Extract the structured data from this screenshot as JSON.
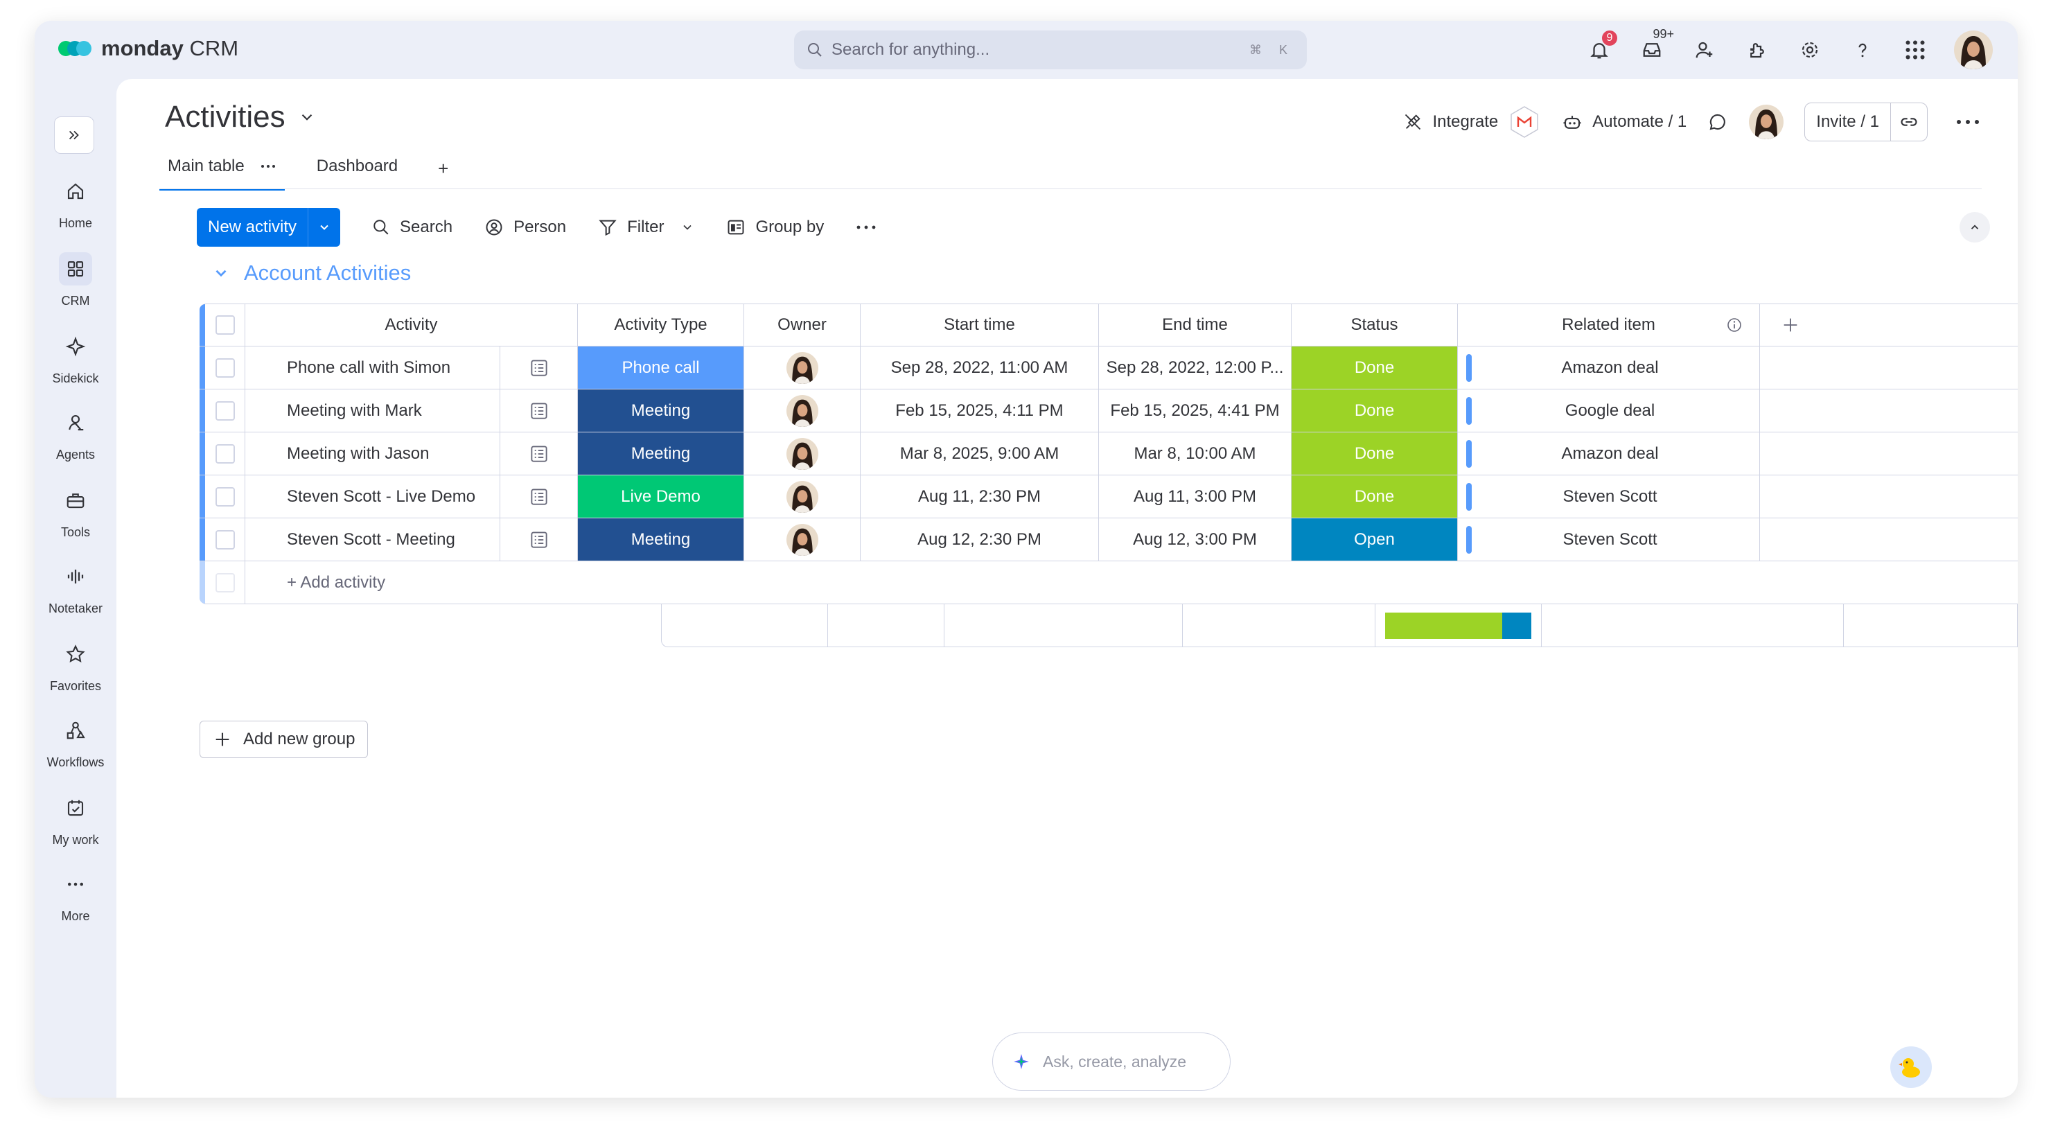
{
  "app": {
    "logo_brand": "monday",
    "logo_product": "CRM",
    "logo_colors": [
      "#00ca72",
      "#00a3b8",
      "#36c3e0"
    ]
  },
  "search": {
    "placeholder": "Search for anything...",
    "shortcut": "⌘ K"
  },
  "topbar": {
    "notifications_badge": "9",
    "inbox_badge": "99+",
    "icons": [
      "bell-icon",
      "inbox-icon",
      "invite-members-icon",
      "apps-icon",
      "settings-icon",
      "help-icon",
      "app-grid-icon",
      "avatar"
    ]
  },
  "rail": {
    "items": [
      {
        "label": "Home",
        "icon": "home-icon"
      },
      {
        "label": "CRM",
        "icon": "grid-icon",
        "active": true
      },
      {
        "label": "Sidekick",
        "icon": "sparkle-icon"
      },
      {
        "label": "Agents",
        "icon": "agents-icon"
      },
      {
        "label": "Tools",
        "icon": "toolbox-icon"
      },
      {
        "label": "Notetaker",
        "icon": "waveform-icon"
      },
      {
        "label": "Favorites",
        "icon": "star-icon"
      },
      {
        "label": "Workflows",
        "icon": "workflows-icon"
      },
      {
        "label": "My work",
        "icon": "calendar-check-icon"
      },
      {
        "label": "More",
        "icon": "more-icon"
      }
    ]
  },
  "board": {
    "title": "Activities",
    "integrate_label": "Integrate",
    "automate_label": "Automate / 1",
    "invite_label": "Invite / 1",
    "tabs": [
      {
        "label": "Main table",
        "active": true
      },
      {
        "label": "Dashboard"
      }
    ],
    "add_tab": "+"
  },
  "toolbar": {
    "new_label": "New activity",
    "search_label": "Search",
    "person_label": "Person",
    "filter_label": "Filter",
    "group_by_label": "Group by"
  },
  "group": {
    "title": "Account Activities",
    "color": "#579bfc",
    "columns": {
      "activity": "Activity",
      "type": "Activity Type",
      "owner": "Owner",
      "start": "Start time",
      "end": "End time",
      "status": "Status",
      "related": "Related item"
    },
    "rows": [
      {
        "activity": "Phone call with Simon",
        "type": "Phone call",
        "type_color": "#579bfc",
        "start": "Sep 28, 2022, 11:00 AM",
        "end": "Sep 28, 2022, 12:00 P...",
        "status": "Done",
        "status_color": "#9cd326",
        "related": "Amazon deal"
      },
      {
        "activity": "Meeting with Mark",
        "type": "Meeting",
        "type_color": "#225091",
        "start": "Feb 15, 2025, 4:11 PM",
        "end": "Feb 15, 2025, 4:41 PM",
        "status": "Done",
        "status_color": "#9cd326",
        "related": "Google deal"
      },
      {
        "activity": "Meeting with Jason",
        "type": "Meeting",
        "type_color": "#225091",
        "start": "Mar 8, 2025, 9:00 AM",
        "end": "Mar 8, 10:00 AM",
        "status": "Done",
        "status_color": "#9cd326",
        "related": "Amazon deal"
      },
      {
        "activity": "Steven Scott - Live Demo",
        "type": "Live Demo",
        "type_color": "#00c875",
        "start": "Aug 11, 2:30 PM",
        "end": "Aug 11, 3:00 PM",
        "status": "Done",
        "status_color": "#9cd326",
        "related": "Steven Scott"
      },
      {
        "activity": "Steven Scott - Meeting",
        "type": "Meeting",
        "type_color": "#225091",
        "start": "Aug 12, 2:30 PM",
        "end": "Aug 12, 3:00 PM",
        "status": "Open",
        "status_color": "#0086c0",
        "related": "Steven Scott"
      }
    ],
    "add_row_label": "+ Add activity",
    "status_summary": [
      {
        "status": "Done",
        "fraction": 0.8,
        "color": "#9cd326"
      },
      {
        "status": "Open",
        "fraction": 0.2,
        "color": "#0086c0"
      }
    ]
  },
  "add_group_label": "Add new group",
  "ask": {
    "placeholder": "Ask, create, analyze"
  }
}
